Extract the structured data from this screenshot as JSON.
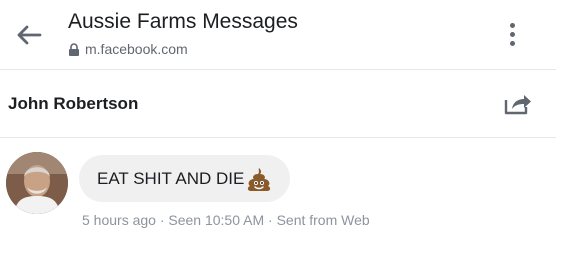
{
  "browser": {
    "title": "Aussie Farms Messages",
    "url": "m.facebook.com",
    "icons": {
      "back": "arrow-left-icon",
      "lock": "lock-icon",
      "menu": "kebab-menu-icon"
    }
  },
  "conversation": {
    "contact_name": "John Robertson",
    "share_icon": "share-icon"
  },
  "messages": [
    {
      "text": "EAT SHIT AND DIE",
      "emoji": "pile-of-poo-emoji",
      "meta": "5 hours ago · Seen 10:50 AM · Sent from Web"
    }
  ],
  "colors": {
    "bubble": "#f1f0f0",
    "meta_text": "#8d949e",
    "icon": "#606770",
    "divider": "#e6e7ea"
  }
}
